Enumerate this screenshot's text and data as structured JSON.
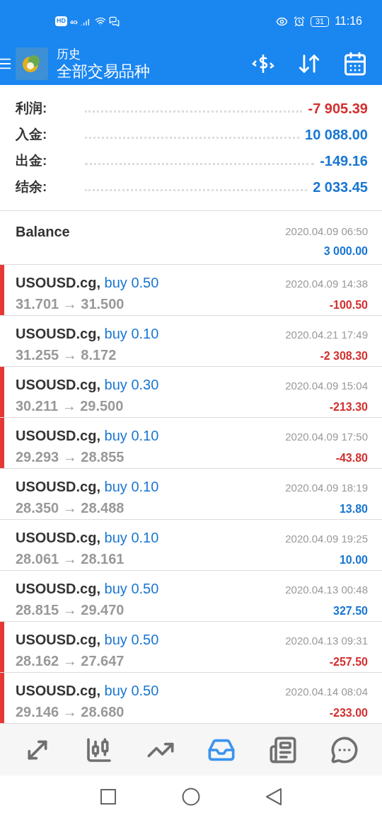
{
  "status_bar": {
    "hd": "HD",
    "network": "4G",
    "battery": "31",
    "time": "11:16"
  },
  "app_bar": {
    "title": "历史",
    "subtitle": "全部交易品种"
  },
  "summary": [
    {
      "label": "利润:",
      "value": "-7 905.39",
      "color": "#d32f2f"
    },
    {
      "label": "入金:",
      "value": "10 088.00",
      "color": "#1976d2"
    },
    {
      "label": "出金:",
      "value": "-149.16",
      "color": "#1976d2"
    },
    {
      "label": "结余:",
      "value": "2 033.45",
      "color": "#1976d2"
    }
  ],
  "balance": {
    "label": "Balance",
    "time": "2020.04.09 06:50",
    "amount": "3 000.00",
    "color": "#1976d2"
  },
  "trades": [
    {
      "symbol": "USOUSD.cg,",
      "side": "buy 0.50",
      "prices": "31.701 → 31.500",
      "time": "2020.04.09 14:38",
      "profit": "-100.50",
      "color": "#d32f2f",
      "flagged": true
    },
    {
      "symbol": "USOUSD.cg,",
      "side": "buy 0.10",
      "prices": "31.255 → 8.172",
      "time": "2020.04.21 17:49",
      "profit": "-2 308.30",
      "color": "#d32f2f",
      "flagged": false
    },
    {
      "symbol": "USOUSD.cg,",
      "side": "buy 0.30",
      "prices": "30.211 → 29.500",
      "time": "2020.04.09 15:04",
      "profit": "-213.30",
      "color": "#d32f2f",
      "flagged": true
    },
    {
      "symbol": "USOUSD.cg,",
      "side": "buy 0.10",
      "prices": "29.293 → 28.855",
      "time": "2020.04.09 17:50",
      "profit": "-43.80",
      "color": "#d32f2f",
      "flagged": true
    },
    {
      "symbol": "USOUSD.cg,",
      "side": "buy 0.10",
      "prices": "28.350 → 28.488",
      "time": "2020.04.09 18:19",
      "profit": "13.80",
      "color": "#1976d2",
      "flagged": false
    },
    {
      "symbol": "USOUSD.cg,",
      "side": "buy 0.10",
      "prices": "28.061 → 28.161",
      "time": "2020.04.09 19:25",
      "profit": "10.00",
      "color": "#1976d2",
      "flagged": false
    },
    {
      "symbol": "USOUSD.cg,",
      "side": "buy 0.50",
      "prices": "28.815 → 29.470",
      "time": "2020.04.13 00:48",
      "profit": "327.50",
      "color": "#1976d2",
      "flagged": false
    },
    {
      "symbol": "USOUSD.cg,",
      "side": "buy 0.50",
      "prices": "28.162 → 27.647",
      "time": "2020.04.13 09:31",
      "profit": "-257.50",
      "color": "#d32f2f",
      "flagged": true
    },
    {
      "symbol": "USOUSD.cg,",
      "side": "buy 0.50",
      "prices": "29.146 → 28.680",
      "time": "2020.04.14 08:04",
      "profit": "-233.00",
      "color": "#d32f2f",
      "flagged": true
    }
  ],
  "bottom_nav": [
    {
      "kind": "quotes",
      "selected": false
    },
    {
      "kind": "chart",
      "selected": false
    },
    {
      "kind": "trade",
      "selected": false
    },
    {
      "kind": "history",
      "selected": true
    },
    {
      "kind": "news",
      "selected": false
    },
    {
      "kind": "chat",
      "selected": false
    }
  ]
}
